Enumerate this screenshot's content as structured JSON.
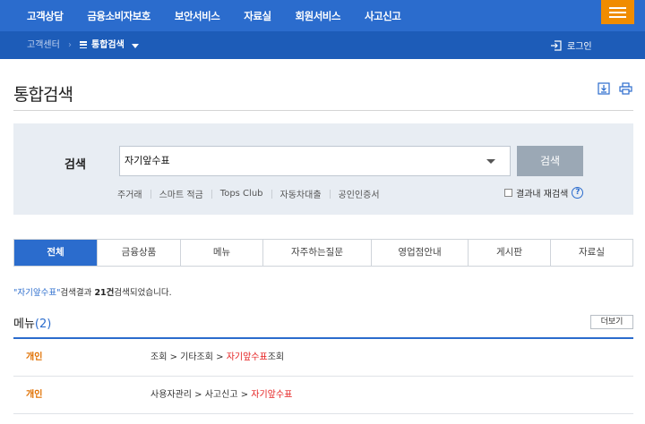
{
  "topnav": {
    "items": [
      "고객상담",
      "금융소비자보호",
      "보안서비스",
      "자료실",
      "회원서비스",
      "사고신고"
    ],
    "menu_icon": "hamburger-icon"
  },
  "subnav": {
    "home": "고객센터",
    "current": "통합검색",
    "login": "로그인"
  },
  "page": {
    "title": "통합검색",
    "tools": [
      "download-icon",
      "print-icon"
    ]
  },
  "search": {
    "label": "검색",
    "value": "자기앞수표",
    "button": "검색",
    "keywords": [
      "주거래",
      "스마트 적금",
      "Tops Club",
      "자동차대출",
      "공인인증서"
    ],
    "rescan_label": "결과내 재검색",
    "help": "?"
  },
  "tabs": [
    "전체",
    "금융상품",
    "메뉴",
    "자주하는질문",
    "영업점안내",
    "게시판",
    "자료실"
  ],
  "result": {
    "keyword": "\"자기앞수표\"",
    "text1": "검색결과 ",
    "count": "21건",
    "text2": "검색되었습니다."
  },
  "menu_section": {
    "title": "메뉴",
    "count": "(2)",
    "more": "더보기",
    "rows": [
      {
        "category": "개인",
        "path": "조회 > 기타조회 > ",
        "highlight": "자기앞수표",
        "suffix": "조회"
      },
      {
        "category": "개인",
        "path": "사용자관리 > 사고신고 > ",
        "highlight": "자기앞수표",
        "suffix": ""
      }
    ]
  },
  "colors": {
    "primary": "#2b6ccd",
    "subnav": "#1d5cb8",
    "accent_orange": "#f08c00",
    "highlight_red": "#e52222"
  }
}
